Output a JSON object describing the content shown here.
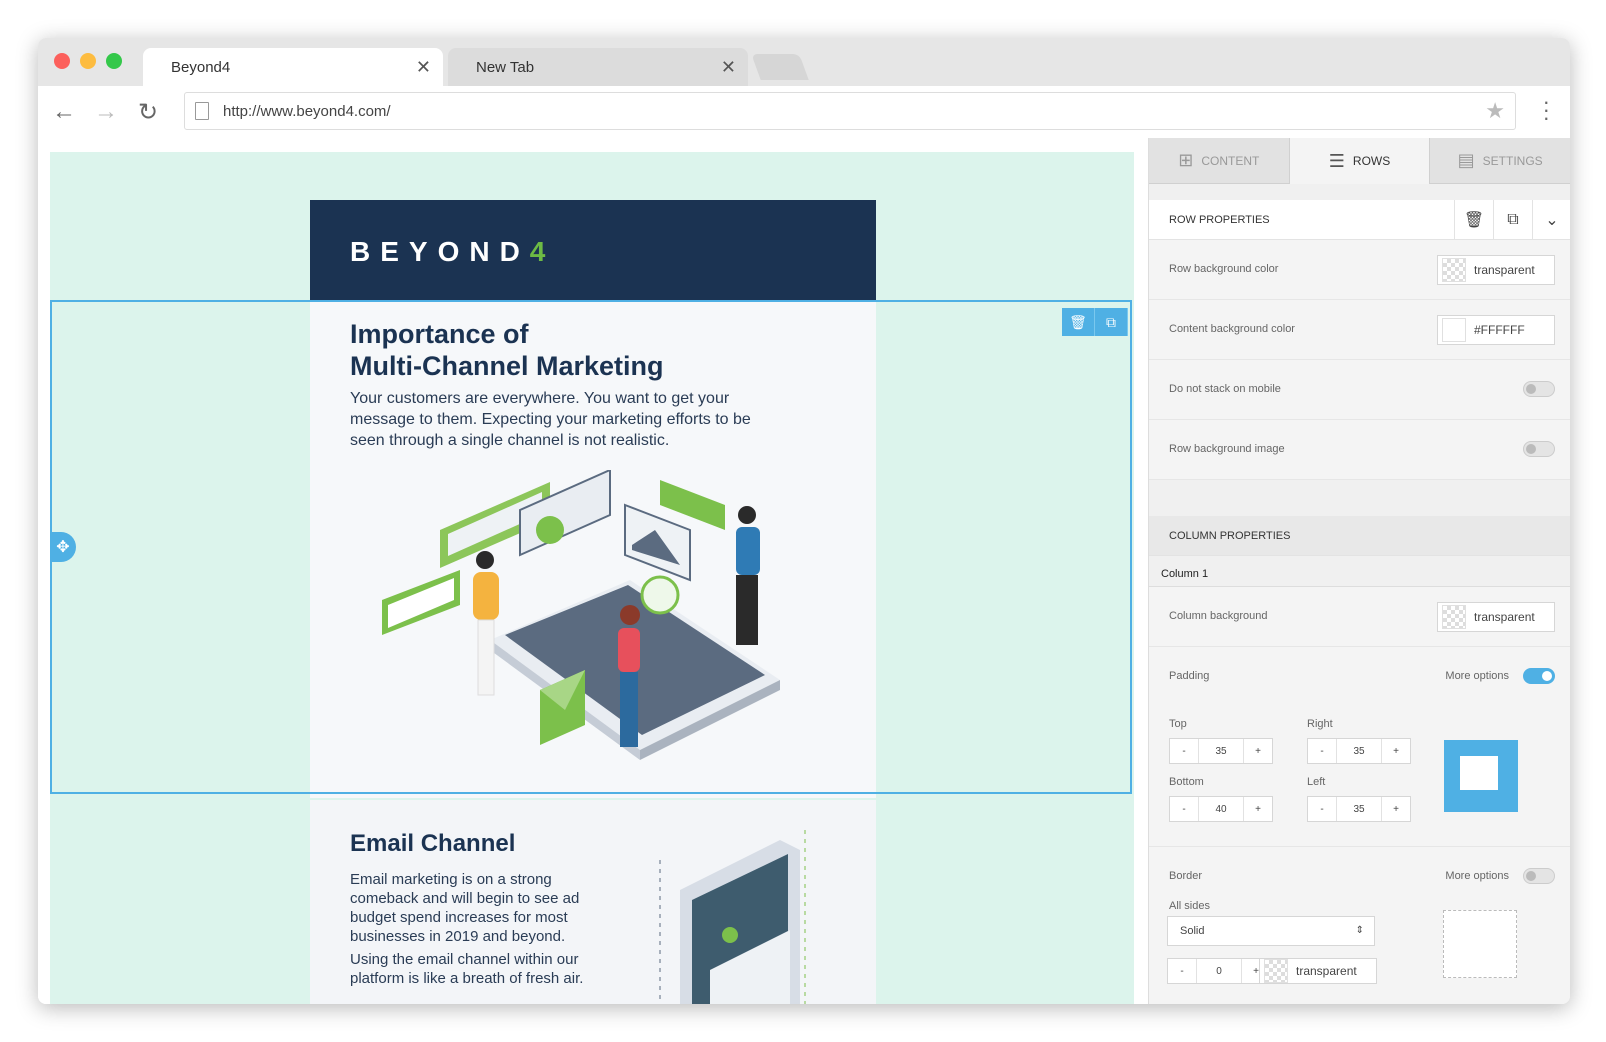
{
  "browser": {
    "tabs": [
      {
        "title": "Beyond4",
        "close": "✕"
      },
      {
        "title": "New Tab",
        "close": "✕"
      }
    ],
    "url": "http://www.beyond4.com/"
  },
  "email": {
    "logo_text": "BEYOND",
    "logo_mark": "4",
    "hero": {
      "title_line1": "Importance of",
      "title_line2": "Multi-Channel Marketing",
      "body": "Your customers are everywhere. You want to get your message to them. Expecting your marketing efforts to be seen through a single channel is not realistic."
    },
    "section2": {
      "title": "Email Channel",
      "p1": "Email marketing is on a strong comeback and will begin to see ad budget spend increases for most businesses in 2019 and beyond.",
      "p2": "Using the email channel within our platform is like a breath of fresh air."
    }
  },
  "sidebar": {
    "tabs": [
      {
        "label": "CONTENT",
        "icon": "grid-icon"
      },
      {
        "label": "ROWS",
        "icon": "rows-icon"
      },
      {
        "label": "SETTINGS",
        "icon": "settings-list-icon"
      }
    ],
    "row_properties": {
      "header": "ROW PROPERTIES",
      "row_bg_label": "Row background color",
      "row_bg_value": "transparent",
      "content_bg_label": "Content background color",
      "content_bg_value": "#FFFFFF",
      "no_stack_label": "Do not stack on mobile",
      "row_bg_image_label": "Row background image"
    },
    "column_properties": {
      "header": "COLUMN PROPERTIES",
      "tab": "Column 1",
      "col_bg_label": "Column background",
      "col_bg_value": "transparent",
      "padding_label": "Padding",
      "more_options": "More options",
      "top_label": "Top",
      "right_label": "Right",
      "bottom_label": "Bottom",
      "left_label": "Left",
      "top": "35",
      "right": "35",
      "bottom": "40",
      "left": "35",
      "border_label": "Border",
      "border_more": "More options",
      "all_sides": "All sides",
      "border_style": "Solid",
      "border_width": "0",
      "border_color": "transparent"
    }
  },
  "colors": {
    "accent": "#4fb0e4",
    "navy": "#1b3352",
    "mint": "#dcf4ec",
    "green": "#6dbb44"
  }
}
